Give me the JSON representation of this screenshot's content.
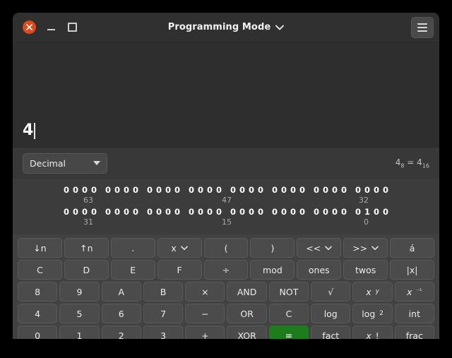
{
  "window": {
    "title": "Programming Mode",
    "close_icon": "close-icon",
    "minimize_icon": "minimize-icon",
    "maximize_icon": "maximize-icon",
    "menu_icon": "hamburger-menu-icon",
    "title_chevron_icon": "chevron-down-icon",
    "accent_close_color": "#e0491a"
  },
  "display": {
    "value": "4"
  },
  "base_bar": {
    "selected_base": "Decimal",
    "dropdown_icon": "chevron-down-icon",
    "conversion": {
      "octal_value": "4",
      "octal_sub": "8",
      "equals": "=",
      "hex_value": "4",
      "hex_sub": "16"
    }
  },
  "bits": {
    "row_high": {
      "groups": [
        "0000",
        "0000",
        "0000",
        "0000",
        "0000",
        "0000",
        "0000",
        "0000"
      ],
      "label_left": "63",
      "label_mid": "47",
      "label_right": "32"
    },
    "row_low": {
      "groups": [
        "0000",
        "0000",
        "0000",
        "0000",
        "0000",
        "0000",
        "0000",
        "0100"
      ],
      "label_left": "31",
      "label_mid": "15",
      "label_right": "0"
    }
  },
  "keypad": {
    "rows": [
      [
        {
          "label": "↓n",
          "name": "subscript-button"
        },
        {
          "label": "↑n",
          "name": "superscript-button"
        },
        {
          "label": ".",
          "name": "decimal-point-button"
        },
        {
          "label": "x",
          "name": "variable-x-button",
          "chevron": true
        },
        {
          "label": "(",
          "name": "open-paren-button"
        },
        {
          "label": ")",
          "name": "close-paren-button"
        },
        {
          "label": "<<",
          "name": "shift-left-button",
          "chevron": true
        },
        {
          "label": ">>",
          "name": "shift-right-button",
          "chevron": true
        },
        {
          "label": "á",
          "name": "store-variable-button"
        }
      ],
      [
        {
          "label": "C",
          "name": "hex-c-button"
        },
        {
          "label": "D",
          "name": "hex-d-button"
        },
        {
          "label": "E",
          "name": "hex-e-button"
        },
        {
          "label": "F",
          "name": "hex-f-button"
        },
        {
          "label": "÷",
          "name": "divide-button"
        },
        {
          "label": "mod",
          "name": "modulus-button"
        },
        {
          "label": "ones",
          "name": "ones-complement-button"
        },
        {
          "label": "twos",
          "name": "twos-complement-button"
        },
        {
          "label": "|x|",
          "name": "absolute-value-button"
        }
      ],
      [
        {
          "label": "8",
          "name": "digit-8-button"
        },
        {
          "label": "9",
          "name": "digit-9-button"
        },
        {
          "label": "A",
          "name": "hex-a-button"
        },
        {
          "label": "B",
          "name": "hex-b-button"
        },
        {
          "label": "×",
          "name": "multiply-button"
        },
        {
          "label": "AND",
          "name": "and-button"
        },
        {
          "label": "NOT",
          "name": "not-button"
        },
        {
          "label": "√",
          "name": "square-root-button"
        },
        {
          "label": "x^y",
          "name": "power-button",
          "html": "<span class=\"ital\">x</span><span class=\"sup ital\">y</span>"
        },
        {
          "label": "x⁻¹",
          "name": "reciprocal-button",
          "html": "<span class=\"ital\">x</span><span class=\"sup\">⁻¹</span>"
        }
      ],
      [
        {
          "label": "4",
          "name": "digit-4-button"
        },
        {
          "label": "5",
          "name": "digit-5-button"
        },
        {
          "label": "6",
          "name": "digit-6-button"
        },
        {
          "label": "7",
          "name": "digit-7-button"
        },
        {
          "label": "−",
          "name": "subtract-button"
        },
        {
          "label": "OR",
          "name": "or-button"
        },
        {
          "label": "C",
          "name": "clear-button"
        },
        {
          "label": "log",
          "name": "log-button"
        },
        {
          "label": "log2",
          "name": "log-base-2-button",
          "html": "log<span class=\"sub\">2</span>"
        },
        {
          "label": "int",
          "name": "integer-part-button"
        }
      ],
      [
        {
          "label": "0",
          "name": "digit-0-button"
        },
        {
          "label": "1",
          "name": "digit-1-button"
        },
        {
          "label": "2",
          "name": "digit-2-button"
        },
        {
          "label": "3",
          "name": "digit-3-button"
        },
        {
          "label": "+",
          "name": "add-button"
        },
        {
          "label": "XOR",
          "name": "xor-button"
        },
        {
          "label": "=",
          "name": "equals-button",
          "accent": "#1d7d1d"
        },
        {
          "label": "fact",
          "name": "factorial-function-button"
        },
        {
          "label": "x!",
          "name": "factorial-button",
          "html": "<span class=\"ital\">x</span>!"
        },
        {
          "label": "frac",
          "name": "fractional-part-button"
        }
      ]
    ]
  }
}
